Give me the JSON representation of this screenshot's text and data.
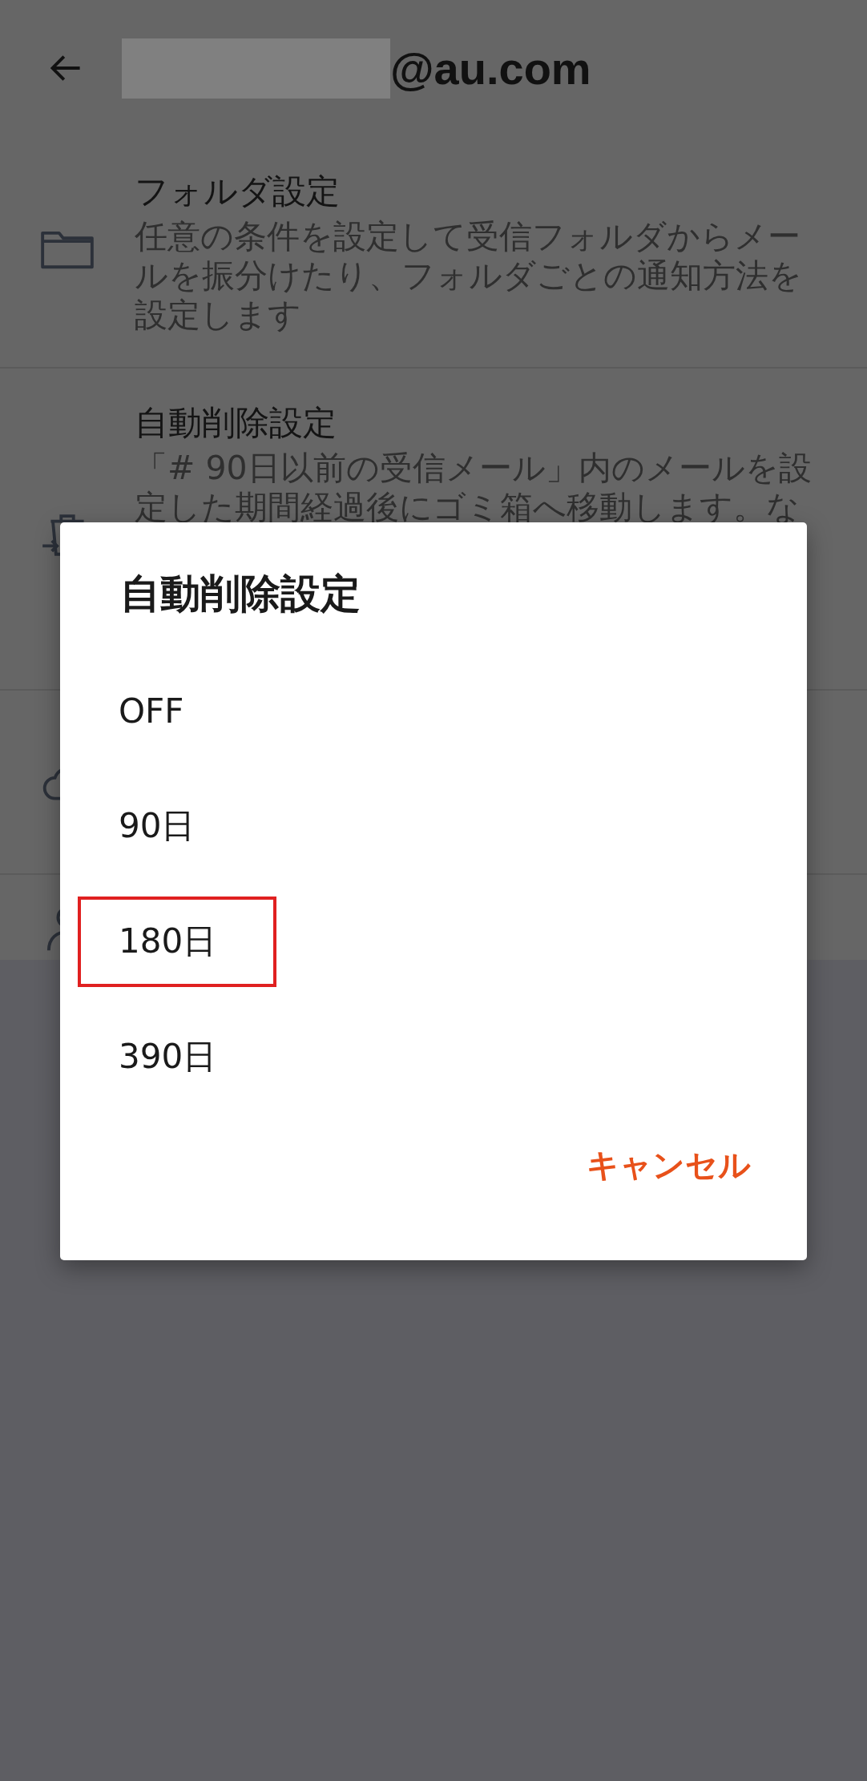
{
  "header": {
    "title": "@au.com"
  },
  "settings": [
    {
      "kind": "folder",
      "title": "フォルダ設定",
      "description": "任意の条件を設定して受信フォルダからメールを振分けたり、フォルダごとの通知方法を設定します"
    },
    {
      "kind": "trash",
      "title": "自動削除設定",
      "description": "「# 90日以前の受信メール」内のメールを設定した期間経過後にゴミ箱へ移動します。な"
    },
    {
      "kind": "cloud"
    },
    {
      "kind": "person"
    }
  ],
  "dialog": {
    "title": "自動削除設定",
    "options": [
      {
        "label": "OFF",
        "marked": false
      },
      {
        "label": "90日",
        "marked": false
      },
      {
        "label": "180日",
        "marked": true
      },
      {
        "label": "390日",
        "marked": false
      }
    ],
    "cancel": "キャンセル"
  }
}
